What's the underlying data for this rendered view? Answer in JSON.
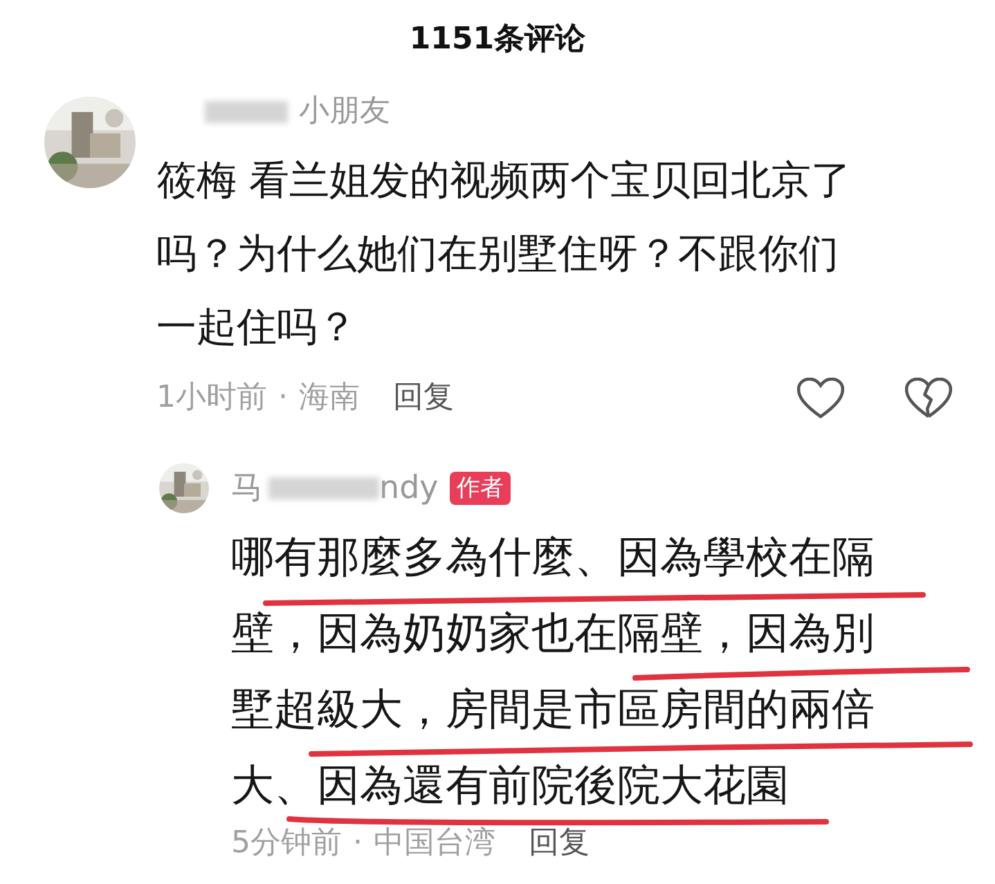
{
  "header": {
    "title": "1151条评论"
  },
  "comment": {
    "author": "小朋友",
    "text": "筱梅 看兰姐发的视频两个宝贝回北京了吗？为什么她们在别墅住呀？不跟你们一起住吗？",
    "time": "1小时前",
    "separator": "·",
    "location": "海南",
    "reply_label": "回复",
    "liked": false,
    "disliked": false,
    "reply": {
      "author_prefix": "马",
      "author_suffix": "ndy",
      "badge": "作者",
      "text_lines": [
        "哪有那麼多為什麼、因為學校在隔",
        "壁，因為奶奶家也在隔壁，因為別",
        "墅超級大，房間是市區房間的兩倍",
        "大、因為還有前院後院大花園"
      ],
      "time": "5分钟前",
      "separator": "·",
      "location": "中国台湾",
      "reply_label": "回复"
    }
  }
}
